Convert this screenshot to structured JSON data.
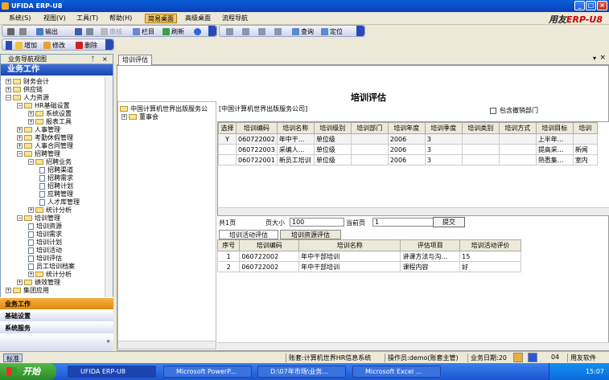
{
  "window": {
    "title": "UFIDA ERP-U8",
    "min": "_",
    "max": "□",
    "close": "×"
  },
  "menu": {
    "items": [
      "系统(S)",
      "视图(V)",
      "工具(T)",
      "帮助(H)",
      "简易桌面",
      "高级桌面",
      "流程导航"
    ],
    "brand_a": "用友",
    "brand_b": "ERP-U8"
  },
  "toolbar1": {
    "output": "输出",
    "columns": "栏目",
    "refresh": "刷新",
    "query": "查询",
    "locate": "定位",
    "disabled": "审核"
  },
  "toolbar2": {
    "add": "增加",
    "edit": "修改",
    "delete": "删除"
  },
  "nav": {
    "title": "业务导航视图",
    "pin": "ᛏ",
    "close": "×",
    "header": "业务工作",
    "tree": [
      "财务会计",
      "供应链",
      "人力资源",
      "HR基础设置",
      "系统设置",
      "报表工具",
      "人事管理",
      "考勤休假管理",
      "人事合同管理",
      "招聘管理",
      "招聘业务",
      "招聘渠道",
      "招聘需求",
      "招聘计划",
      "应聘管理",
      "人才库管理",
      "统计分析",
      "培训管理",
      "培训资源",
      "培训需求",
      "培训计划",
      "培训活动",
      "培训评估",
      "员工培训档案",
      "统计分析",
      "绩效管理",
      "集团应用"
    ],
    "sections": [
      "业务工作",
      "基础设置",
      "系统服务"
    ]
  },
  "tab": {
    "label": "培训评估"
  },
  "page": {
    "title": "培训评估",
    "org_root": "中国计算机世界出版服务公",
    "org_child": "董事会",
    "org_path": "[中国计算机世界出版服务公司]",
    "include_cancelled": "包含撤销部门"
  },
  "grid1": {
    "headers": [
      "选择",
      "培训编码",
      "培训名称",
      "培训级别",
      "培训部门",
      "培训年度",
      "培训季度",
      "培训类别",
      "培训方式",
      "培训目标",
      "培训"
    ],
    "rows": [
      [
        "Y",
        "060722002",
        "年中干...",
        "单位级",
        "",
        "2006",
        "3",
        "",
        "",
        "上半年...",
        ""
      ],
      [
        "",
        "060722003",
        "采编人...",
        "单位级",
        "",
        "2006",
        "3",
        "",
        "",
        "提高采...",
        "新闻"
      ],
      [
        "",
        "060722001",
        "新员工培训",
        "单位级",
        "",
        "2006",
        "3",
        "",
        "",
        "熟悉集...",
        "室内"
      ]
    ]
  },
  "pager": {
    "total": "共1页",
    "size_label": "页大小",
    "size": "100",
    "current_label": "当前页",
    "current": "1",
    "submit": "提交"
  },
  "subtabs": [
    "培训活动评估",
    "培训资源评估"
  ],
  "grid2": {
    "headers": [
      "序号",
      "培训编码",
      "培训名称",
      "评估项目",
      "培训活动评价"
    ],
    "rows": [
      [
        "1",
        "060722002",
        "年中干部培训",
        "讲课方法与沟...",
        "15"
      ],
      [
        "2",
        "060722002",
        "年中干部培训",
        "课程内容",
        "好"
      ]
    ]
  },
  "status": {
    "lang": "标准",
    "account": "账套:计算机世界HR信息系统",
    "operator": "操作员:demo(账套主管)",
    "date_label": "业务日期:20",
    "date_tail": "04",
    "vendor": "用友软件"
  },
  "taskbar": {
    "start": "开始",
    "tasks": [
      "UFIDA ERP-U8",
      "Microsoft PowerP...",
      "D:\\07年市场\\业务...",
      "Microsoft Excel ..."
    ],
    "clock": "15:07"
  }
}
